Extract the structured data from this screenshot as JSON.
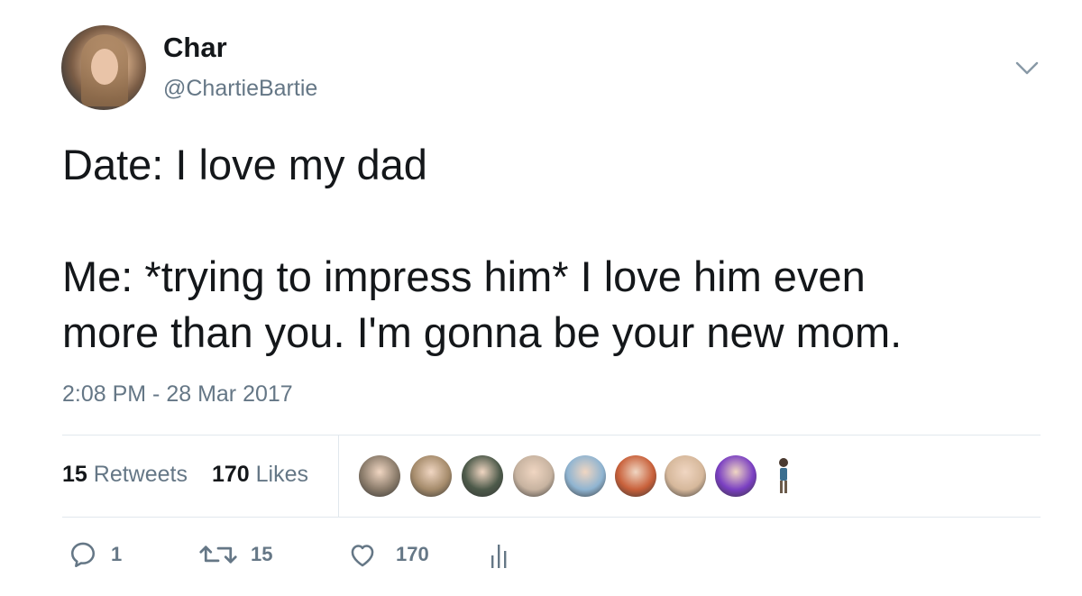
{
  "tweet": {
    "author": {
      "name": "Char",
      "handle": "@ChartieBartie"
    },
    "text_lines": [
      "Date: I love my dad",
      "",
      "Me: *trying to impress him* I love him even",
      "more than you. I'm gonna be your new mom."
    ],
    "timestamp": "2:08 PM - 28 Mar 2017",
    "stats": {
      "retweets_count": "15",
      "retweets_label": "Retweets",
      "likes_count": "170",
      "likes_label": "Likes"
    },
    "likers": [
      {
        "icon": "liker-avatar-1",
        "color": "#8a7b6a"
      },
      {
        "icon": "liker-avatar-2",
        "color": "#a58b6b"
      },
      {
        "icon": "liker-avatar-3",
        "color": "#4d5a4a"
      },
      {
        "icon": "liker-avatar-4",
        "color": "#c7b3a0"
      },
      {
        "icon": "liker-avatar-5",
        "color": "#8fb4d1"
      },
      {
        "icon": "liker-avatar-6",
        "color": "#c8603a"
      },
      {
        "icon": "liker-avatar-7",
        "color": "#d6b89b"
      },
      {
        "icon": "liker-avatar-8",
        "color": "#7a3fc2"
      }
    ],
    "actions": {
      "reply_count": "1",
      "retweet_count": "15",
      "like_count": "170"
    }
  },
  "colors": {
    "text": "#14171a",
    "secondary": "#657786",
    "divider": "#e1e8ed"
  }
}
